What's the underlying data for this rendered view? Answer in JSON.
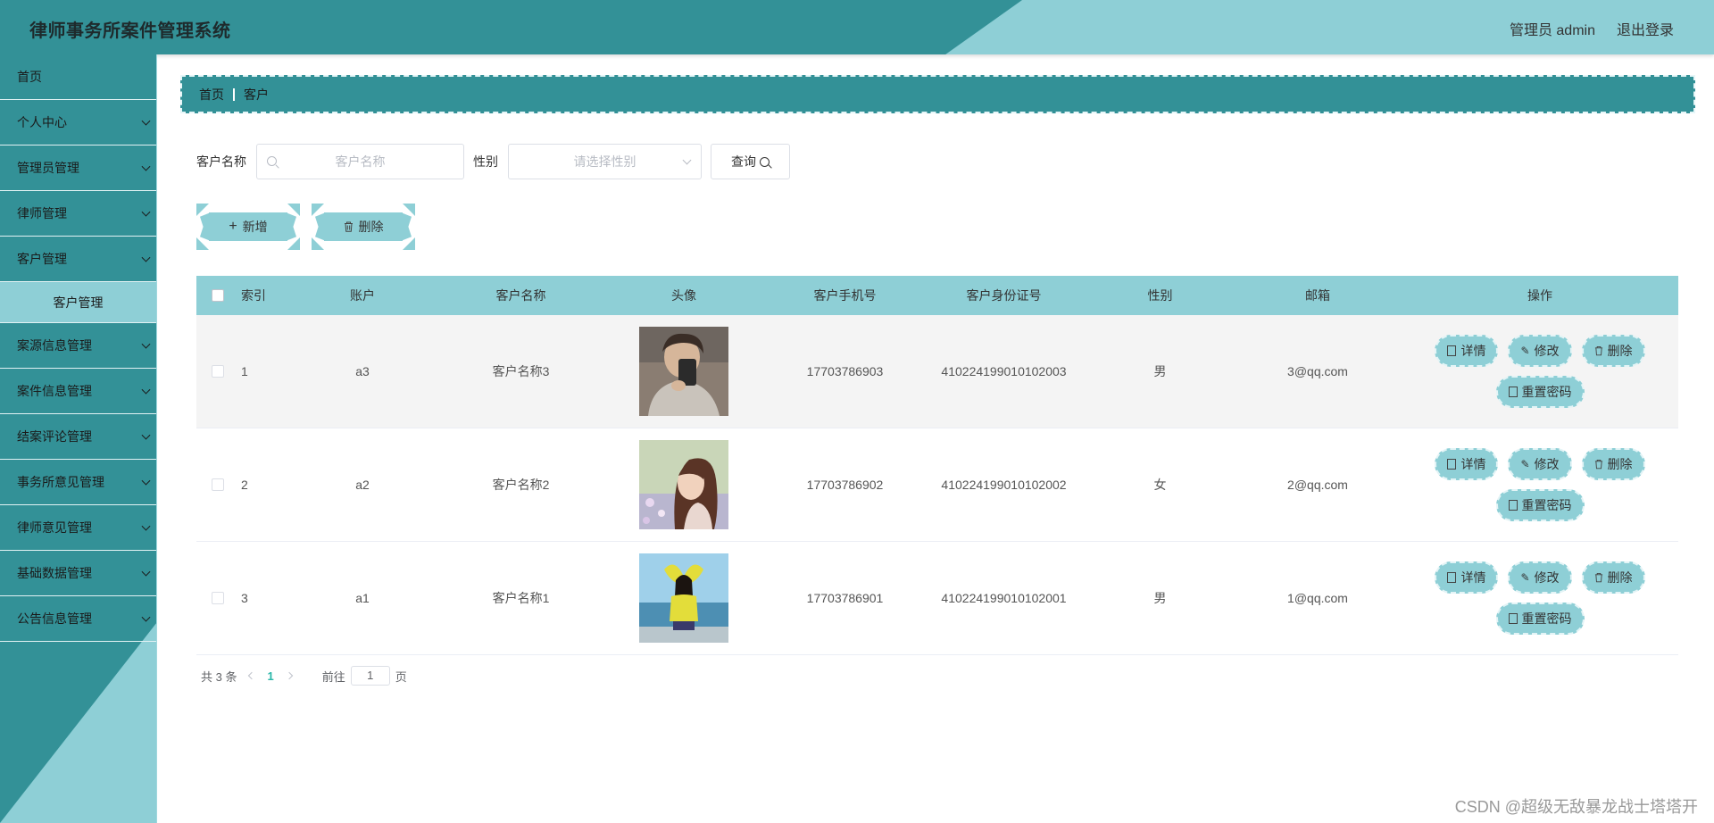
{
  "header": {
    "title": "律师事务所案件管理系统",
    "user_label": "管理员 admin",
    "logout_label": "退出登录"
  },
  "sidebar": {
    "items": [
      {
        "label": "首页",
        "has_chevron": false
      },
      {
        "label": "个人中心",
        "has_chevron": true
      },
      {
        "label": "管理员管理",
        "has_chevron": true
      },
      {
        "label": "律师管理",
        "has_chevron": true
      },
      {
        "label": "客户管理",
        "has_chevron": true
      },
      {
        "label": "案源信息管理",
        "has_chevron": true
      },
      {
        "label": "案件信息管理",
        "has_chevron": true
      },
      {
        "label": "结案评论管理",
        "has_chevron": true
      },
      {
        "label": "事务所意见管理",
        "has_chevron": true
      },
      {
        "label": "律师意见管理",
        "has_chevron": true
      },
      {
        "label": "基础数据管理",
        "has_chevron": true
      },
      {
        "label": "公告信息管理",
        "has_chevron": true
      }
    ],
    "sub_item": "客户管理"
  },
  "breadcrumb": {
    "home": "首页",
    "current": "客户"
  },
  "search": {
    "name_label": "客户名称",
    "name_placeholder": "客户名称",
    "gender_label": "性别",
    "gender_placeholder": "请选择性别",
    "query_label": "查询"
  },
  "actions": {
    "add_label": "新增",
    "delete_label": "删除"
  },
  "table": {
    "columns": [
      "索引",
      "账户",
      "客户名称",
      "头像",
      "客户手机号",
      "客户身份证号",
      "性别",
      "邮箱",
      "操作"
    ],
    "rows": [
      {
        "index": "1",
        "account": "a3",
        "name": "客户名称3",
        "avatar": "man-selfie-photo",
        "phone": "17703786903",
        "id_no": "410224199010102003",
        "gender": "男",
        "email": "3@qq.com"
      },
      {
        "index": "2",
        "account": "a2",
        "name": "客户名称2",
        "avatar": "woman-flowers-photo",
        "phone": "17703786902",
        "id_no": "410224199010102002",
        "gender": "女",
        "email": "2@qq.com"
      },
      {
        "index": "3",
        "account": "a1",
        "name": "客户名称1",
        "avatar": "woman-beach-photo",
        "phone": "17703786901",
        "id_no": "410224199010102001",
        "gender": "男",
        "email": "1@qq.com"
      }
    ],
    "ops": {
      "detail": "详情",
      "edit": "修改",
      "delete": "删除",
      "reset": "重置密码"
    }
  },
  "pagination": {
    "total": "共 3 条",
    "current_page": "1",
    "goto_label": "前往",
    "page_input": "1",
    "page_suffix": "页"
  },
  "watermark": "CSDN @超级无敌暴龙战士塔塔开",
  "colors": {
    "primary_dark": "#339197",
    "primary_light": "#8ecfd6",
    "pager_active": "#2ab7a9"
  }
}
